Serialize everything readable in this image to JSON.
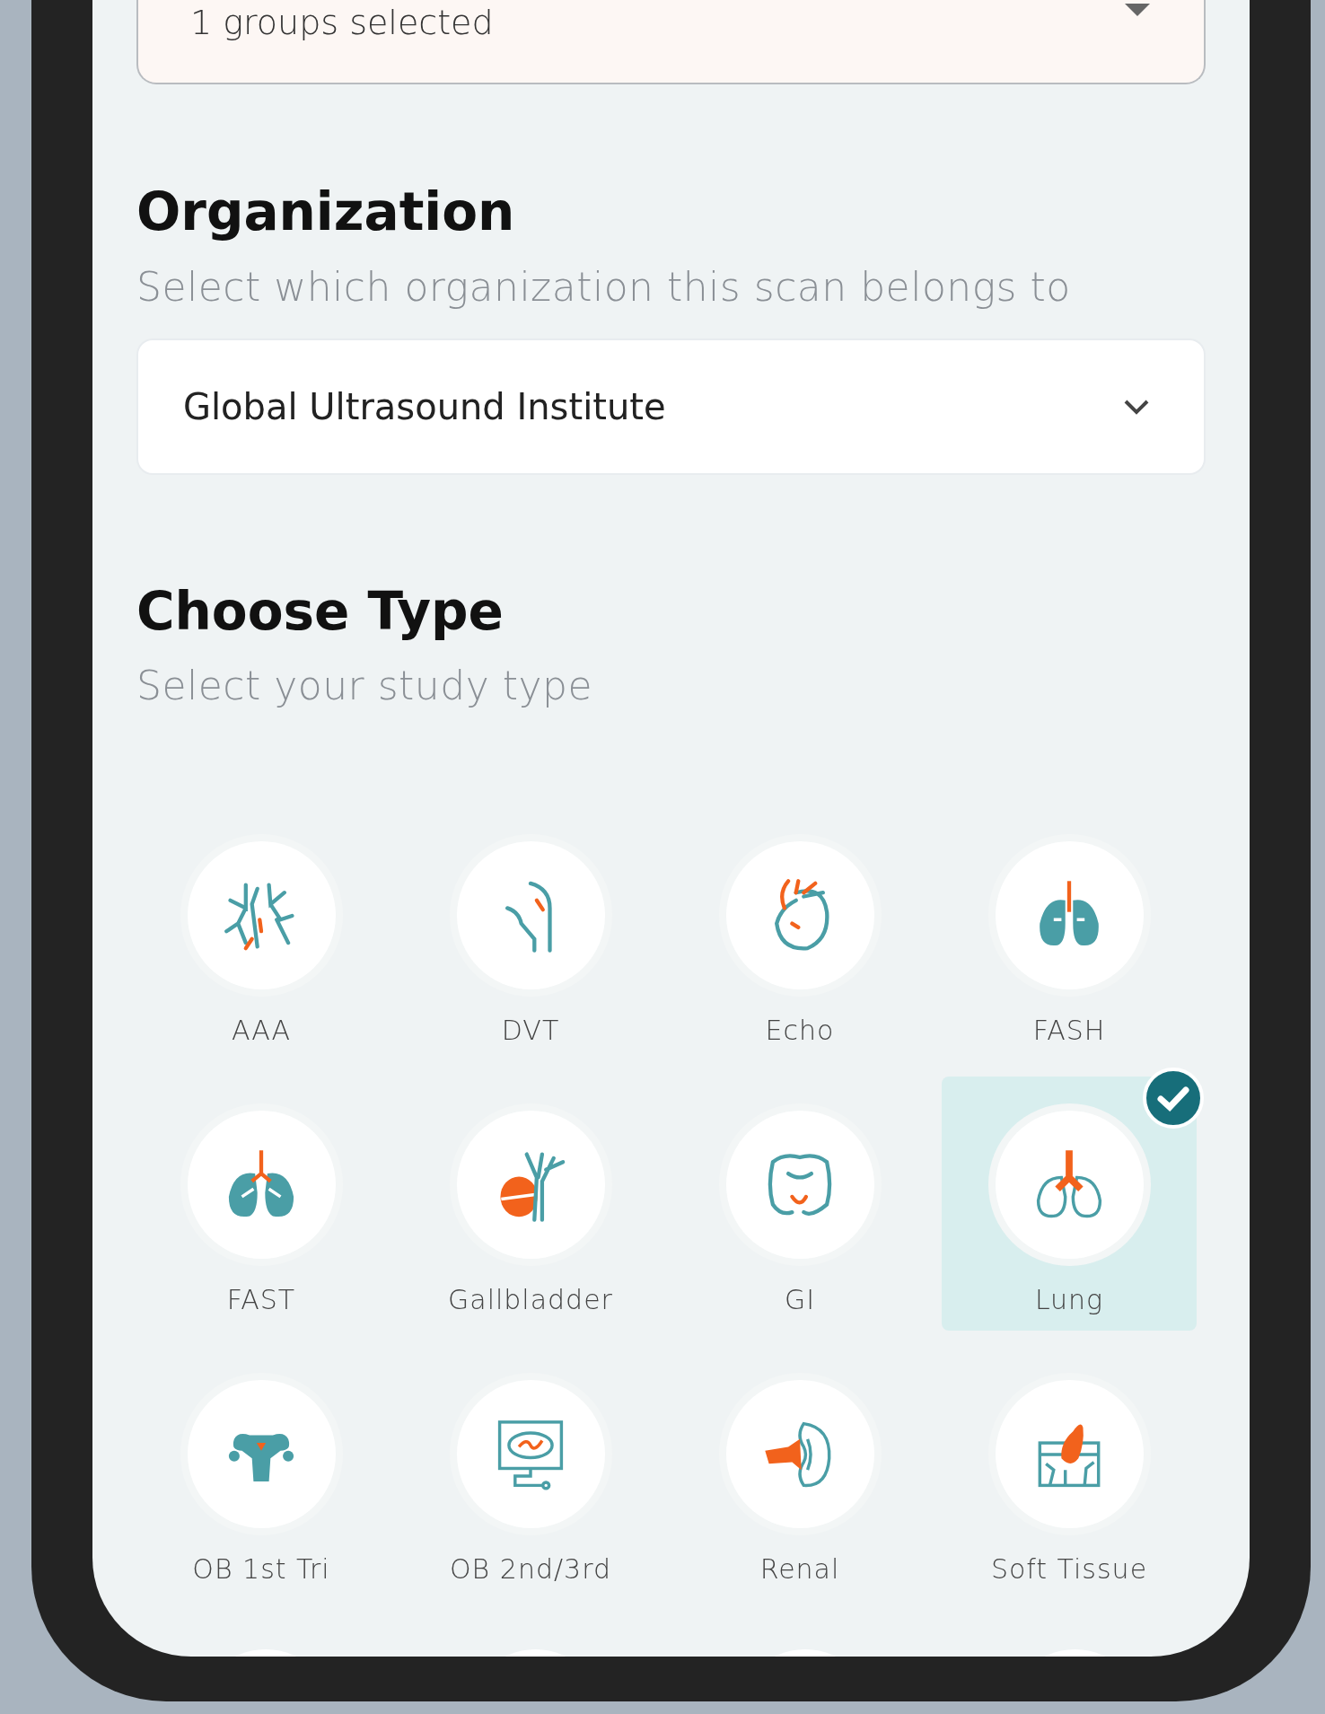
{
  "groups_field": {
    "value": "1 groups selected"
  },
  "organization": {
    "title": "Organization",
    "subtitle": "Select which organization this scan belongs to",
    "value": "Global Ultrasound Institute"
  },
  "choose_type": {
    "title": "Choose Type",
    "subtitle": "Select your study type",
    "types": [
      {
        "label": "AAA",
        "selected": false
      },
      {
        "label": "DVT",
        "selected": false
      },
      {
        "label": "Echo",
        "selected": false
      },
      {
        "label": "FASH",
        "selected": false
      },
      {
        "label": "FAST",
        "selected": false
      },
      {
        "label": "Gallbladder",
        "selected": false
      },
      {
        "label": "GI",
        "selected": false
      },
      {
        "label": "Lung",
        "selected": true
      },
      {
        "label": "OB 1st Tri",
        "selected": false
      },
      {
        "label": "OB 2nd/3rd",
        "selected": false
      },
      {
        "label": "Renal",
        "selected": false
      },
      {
        "label": "Soft Tissue",
        "selected": false
      }
    ]
  }
}
